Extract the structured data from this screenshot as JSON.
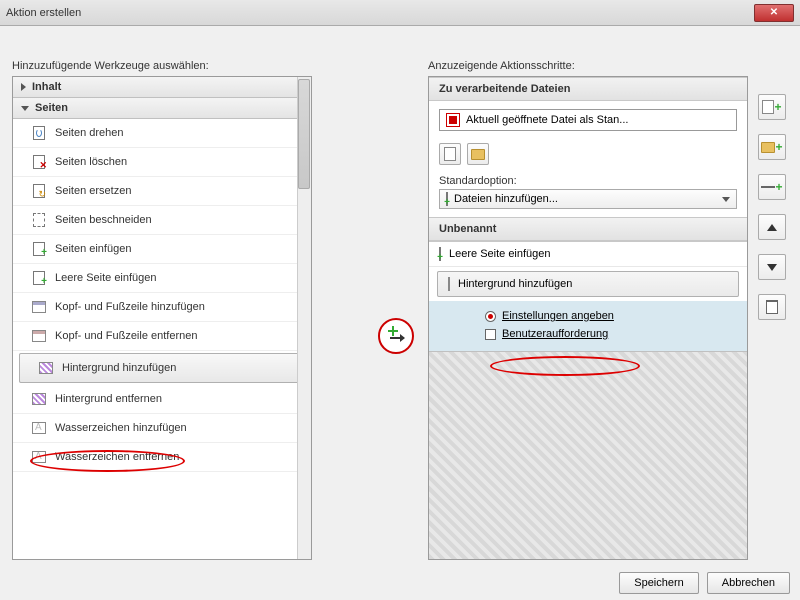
{
  "window": {
    "title": "Aktion erstellen"
  },
  "left": {
    "label": "Hinzuzufügende Werkzeuge auswählen:",
    "groups": {
      "content": {
        "label": "Inhalt",
        "expanded": false
      },
      "pages": {
        "label": "Seiten",
        "expanded": true
      }
    },
    "tools": [
      {
        "id": "rotate",
        "label": "Seiten drehen"
      },
      {
        "id": "delete",
        "label": "Seiten löschen"
      },
      {
        "id": "replace",
        "label": "Seiten ersetzen"
      },
      {
        "id": "crop",
        "label": "Seiten beschneiden"
      },
      {
        "id": "insert",
        "label": "Seiten einfügen"
      },
      {
        "id": "blank",
        "label": "Leere Seite einfügen"
      },
      {
        "id": "hf-add",
        "label": "Kopf- und Fußzeile hinzufügen"
      },
      {
        "id": "hf-rem",
        "label": "Kopf- und Fußzeile entfernen"
      },
      {
        "id": "bg-add",
        "label": "Hintergrund hinzufügen"
      },
      {
        "id": "bg-rem",
        "label": "Hintergrund entfernen"
      },
      {
        "id": "wm-add",
        "label": "Wasserzeichen hinzufügen"
      },
      {
        "id": "wm-rem",
        "label": "Wasserzeichen entfernen"
      }
    ],
    "selected": "bg-add"
  },
  "right": {
    "label": "Anzuzeigende Aktionsschritte:",
    "files_header": "Zu verarbeitende Dateien",
    "file_row": "Aktuell geöffnete Datei als Stan...",
    "std_label": "Standardoption:",
    "std_value": "Dateien hinzufügen...",
    "group_name": "Unbenannt",
    "steps": [
      {
        "id": "blank",
        "label": "Leere Seite einfügen"
      },
      {
        "id": "bg-add",
        "label": "Hintergrund hinzufügen",
        "selected": true
      }
    ],
    "sub": {
      "settings": "Einstellungen angeben",
      "prompt": "Benutzeraufforderung"
    }
  },
  "footer": {
    "save": "Speichern",
    "cancel": "Abbrechen"
  }
}
